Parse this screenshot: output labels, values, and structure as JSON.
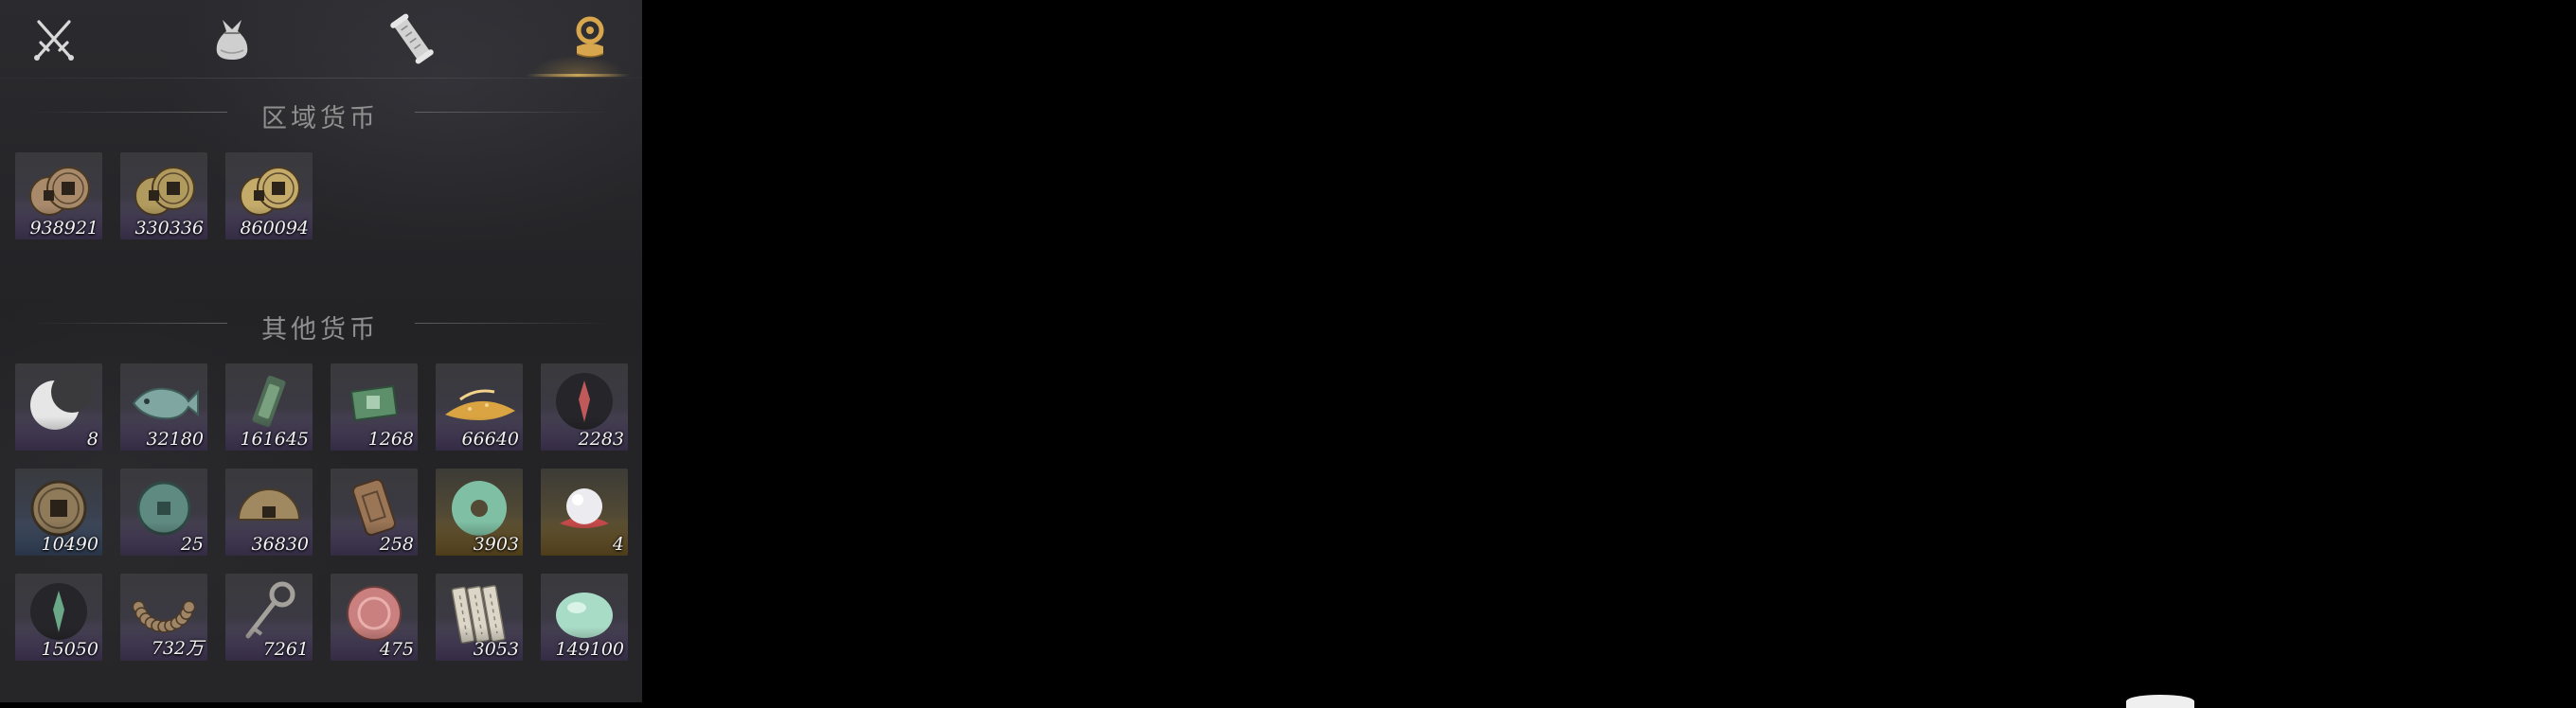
{
  "tabs": [
    {
      "id": "weapons",
      "icon": "crossed-swords-icon",
      "active": false
    },
    {
      "id": "bag",
      "icon": "cloth-bag-icon",
      "active": false
    },
    {
      "id": "scroll",
      "icon": "scroll-icon",
      "active": false
    },
    {
      "id": "currency",
      "icon": "coin-stack-icon",
      "active": true
    }
  ],
  "accent_color": "#c8a45a",
  "sections": {
    "regional": {
      "title": "区域货币",
      "items": [
        {
          "icon": "copper-coins-icon",
          "count": "938921",
          "rarity": "purple",
          "tone": "#a8896a"
        },
        {
          "icon": "bronze-coins-icon",
          "count": "330336",
          "rarity": "purple",
          "tone": "#b09a5e"
        },
        {
          "icon": "gold-coins-icon",
          "count": "860094",
          "rarity": "purple",
          "tone": "#c4ab6a"
        }
      ]
    },
    "other": {
      "title": "其他货币",
      "items": [
        {
          "icon": "crescent-moon-icon",
          "count": "8",
          "rarity": "purple"
        },
        {
          "icon": "jade-fish-icon",
          "count": "32180",
          "rarity": "purple"
        },
        {
          "icon": "jade-token-icon",
          "count": "161645",
          "rarity": "purple"
        },
        {
          "icon": "green-ticket-icon",
          "count": "1268",
          "rarity": "purple"
        },
        {
          "icon": "grain-pile-icon",
          "count": "66640",
          "rarity": "purple"
        },
        {
          "icon": "red-charm-icon",
          "count": "2283",
          "rarity": "purple"
        },
        {
          "icon": "square-hole-coin-icon",
          "count": "10490",
          "rarity": "blue"
        },
        {
          "icon": "jade-coin-icon",
          "count": "25",
          "rarity": "purple"
        },
        {
          "icon": "bronze-half-disc-icon",
          "count": "36830",
          "rarity": "purple"
        },
        {
          "icon": "bronze-plaque-icon",
          "count": "258",
          "rarity": "purple"
        },
        {
          "icon": "jade-bi-disc-icon",
          "count": "3903",
          "rarity": "gold"
        },
        {
          "icon": "pearl-icon",
          "count": "4",
          "rarity": "gold"
        },
        {
          "icon": "green-charm-icon",
          "count": "15050",
          "rarity": "purple"
        },
        {
          "icon": "bead-bracelet-icon",
          "count": "732万",
          "rarity": "purple"
        },
        {
          "icon": "bronze-key-icon",
          "count": "7261",
          "rarity": "purple"
        },
        {
          "icon": "rose-seal-icon",
          "count": "475",
          "rarity": "purple"
        },
        {
          "icon": "bamboo-slips-icon",
          "count": "3053",
          "rarity": "purple"
        },
        {
          "icon": "jade-pebble-icon",
          "count": "149100",
          "rarity": "purple"
        }
      ]
    }
  }
}
